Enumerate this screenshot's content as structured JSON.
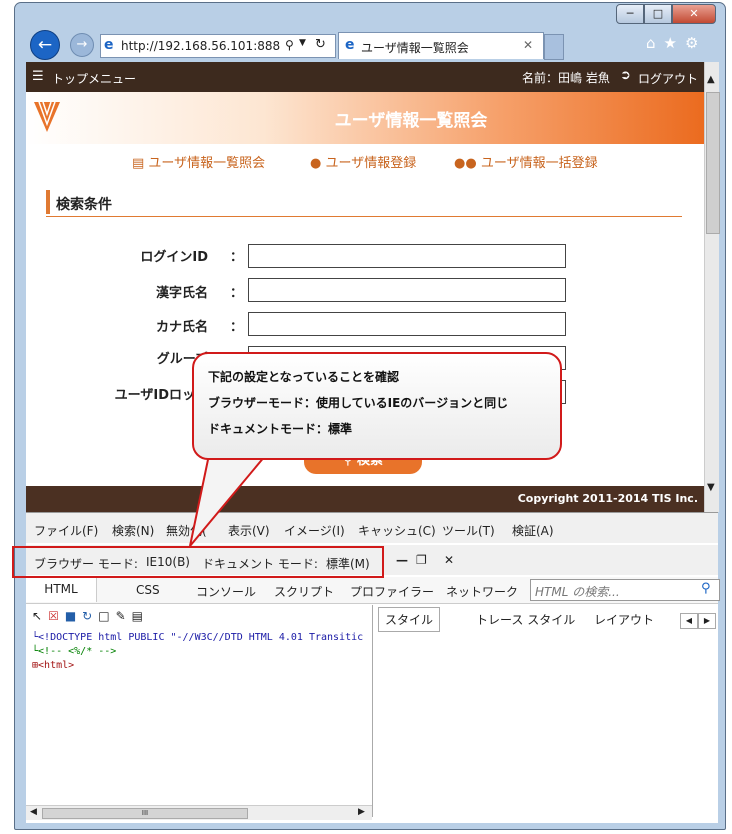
{
  "browser": {
    "url": "http://192.168.56.101:888",
    "tab_title": "ユーザ情報一覧照会",
    "window_buttons": [
      "─",
      "□",
      "✕"
    ]
  },
  "page": {
    "top_menu_label": "トップメニュー",
    "user_name": "名前：田嶋 岩魚",
    "logout_label": "ログアウト",
    "banner_title": "ユーザ情報一覧照会",
    "nav_links": [
      "ユーザ情報一覧照会",
      "ユーザ情報登録",
      "ユーザ情報一括登録"
    ],
    "section_title": "検索条件",
    "fields": [
      {
        "label": "ログインID"
      },
      {
        "label": "漢字氏名"
      },
      {
        "label": "カナ氏名"
      },
      {
        "label": "グループ"
      },
      {
        "label": "ユーザIDロック"
      }
    ],
    "colon": "：",
    "search_button": "検索",
    "copyright": "Copyright 2011-2014 TIS Inc."
  },
  "devtools": {
    "menu": [
      "ファイル(F)",
      "検索(N)",
      "無効化(",
      "表示(V)",
      "イメージ(I)",
      "キャッシュ(C)",
      "ツール(T)",
      "検証(A)"
    ],
    "browser_mode_label": "ブラウザー モード:",
    "browser_mode_value": "IE10(B)",
    "document_mode_label": "ドキュメント モード:",
    "document_mode_value": "標準(M)",
    "tabs": [
      "HTML",
      "CSS",
      "コンソール",
      "スクリプト",
      "プロファイラー",
      "ネットワーク"
    ],
    "search_placeholder": "HTML の検索...",
    "right_tabs": [
      "スタイル",
      "トレース スタイル",
      "レイアウト"
    ],
    "tree": [
      "<!DOCTYPE html PUBLIC \"-//W3C//DTD HTML 4.01 Transitic",
      "<!--  <%/* -->",
      "<html>"
    ],
    "scroll_marker": "III"
  },
  "callout": {
    "lines": [
      "下記の設定となっていることを確認",
      "ブラウザーモード：使用しているIEのバージョンと同じ",
      "ドキュメントモード：標準"
    ]
  },
  "colors": {
    "accent_orange": "#e8732a",
    "header_brown": "#3d2a1e",
    "callout_border": "#d11a1a"
  }
}
